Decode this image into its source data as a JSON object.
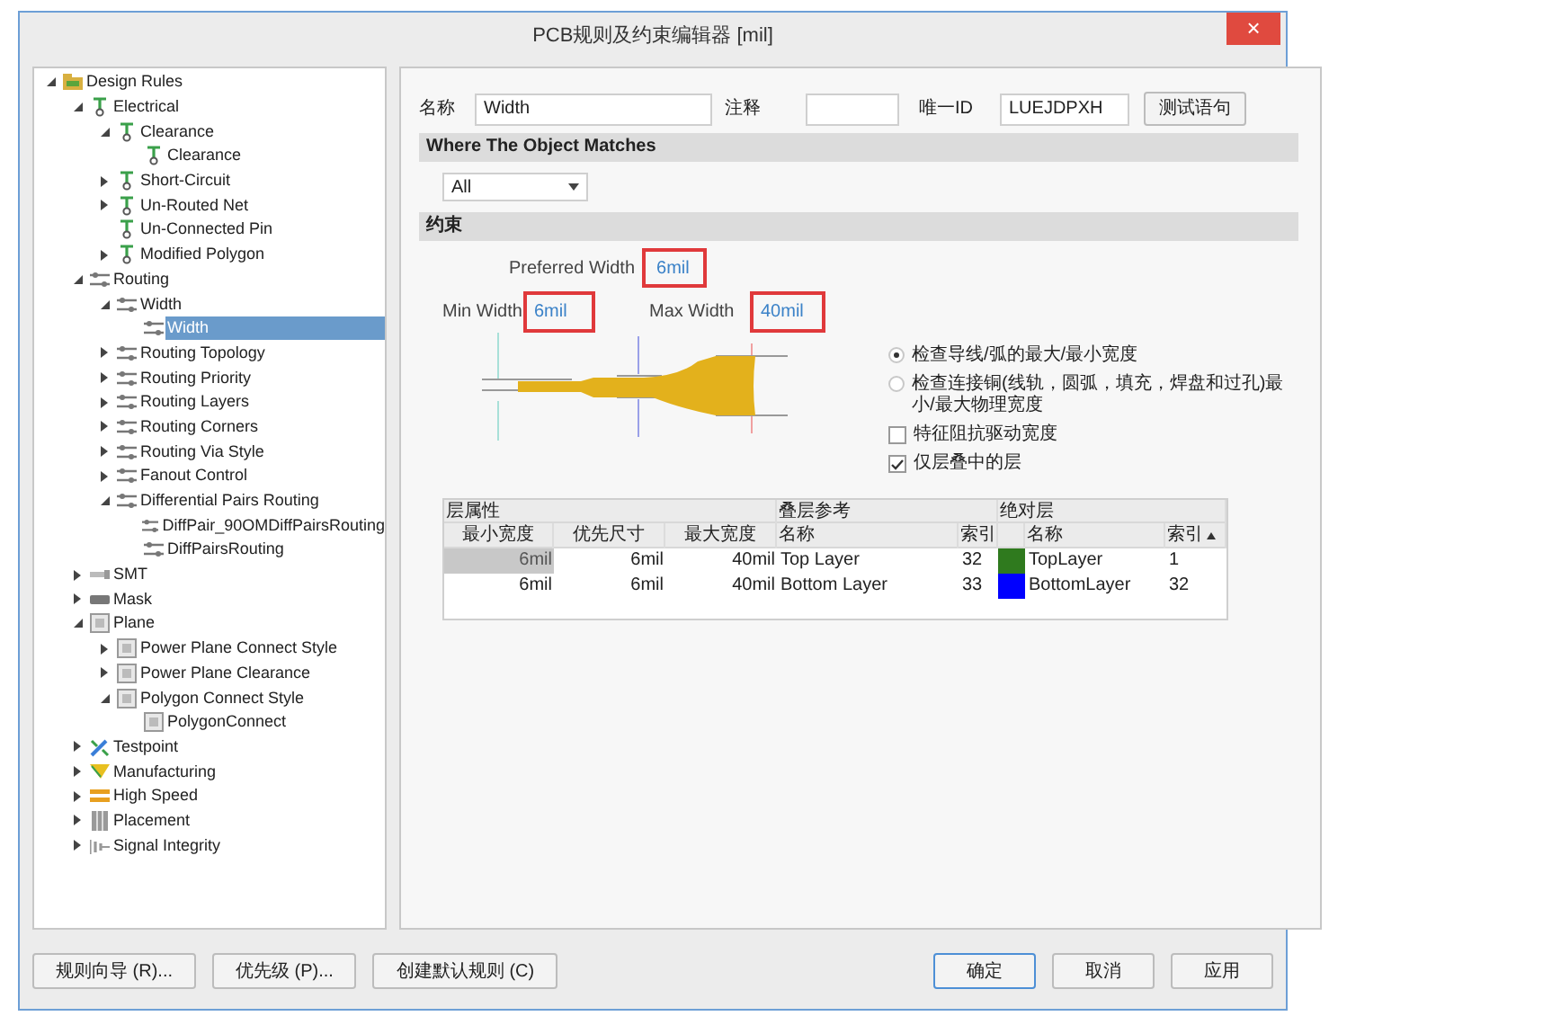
{
  "window": {
    "title": "PCB规则及约束编辑器 [mil]",
    "close": "×"
  },
  "tree": [
    {
      "label": "Design Rules",
      "kind": "folder",
      "expanded": true,
      "selected": false,
      "children": [
        {
          "label": "Electrical",
          "kind": "electrical",
          "expanded": true,
          "selected": false,
          "children": [
            {
              "label": "Clearance",
              "kind": "electrical",
              "expanded": true,
              "selected": false,
              "children": [
                {
                  "label": "Clearance",
                  "kind": "electrical",
                  "selected": false
                }
              ]
            },
            {
              "label": "Short-Circuit",
              "kind": "electrical",
              "expanded": false,
              "selected": false
            },
            {
              "label": "Un-Routed Net",
              "kind": "electrical",
              "expanded": false,
              "selected": false
            },
            {
              "label": "Un-Connected Pin",
              "kind": "electrical",
              "selected": false
            },
            {
              "label": "Modified Polygon",
              "kind": "electrical",
              "expanded": false,
              "selected": false
            }
          ]
        },
        {
          "label": "Routing",
          "kind": "routing",
          "expanded": true,
          "selected": false,
          "children": [
            {
              "label": "Width",
              "kind": "routing",
              "expanded": true,
              "selected": false,
              "children": [
                {
                  "label": "Width",
                  "kind": "routing",
                  "selected": true
                }
              ]
            },
            {
              "label": "Routing Topology",
              "kind": "routing",
              "expanded": false,
              "selected": false
            },
            {
              "label": "Routing Priority",
              "kind": "routing",
              "expanded": false,
              "selected": false
            },
            {
              "label": "Routing Layers",
              "kind": "routing",
              "expanded": false,
              "selected": false
            },
            {
              "label": "Routing Corners",
              "kind": "routing",
              "expanded": false,
              "selected": false
            },
            {
              "label": "Routing Via Style",
              "kind": "routing",
              "expanded": false,
              "selected": false
            },
            {
              "label": "Fanout Control",
              "kind": "routing",
              "expanded": false,
              "selected": false
            },
            {
              "label": "Differential Pairs Routing",
              "kind": "routing",
              "expanded": true,
              "selected": false,
              "children": [
                {
                  "label": "DiffPair_90OMDiffPairsRouting",
                  "kind": "routing",
                  "selected": false
                },
                {
                  "label": "DiffPairsRouting",
                  "kind": "routing",
                  "selected": false
                }
              ]
            }
          ]
        },
        {
          "label": "SMT",
          "kind": "smt",
          "expanded": false,
          "selected": false
        },
        {
          "label": "Mask",
          "kind": "mask",
          "expanded": false,
          "selected": false
        },
        {
          "label": "Plane",
          "kind": "plane",
          "expanded": true,
          "selected": false,
          "children": [
            {
              "label": "Power Plane Connect Style",
              "kind": "plane",
              "expanded": false,
              "selected": false
            },
            {
              "label": "Power Plane Clearance",
              "kind": "plane",
              "expanded": false,
              "selected": false
            },
            {
              "label": "Polygon Connect Style",
              "kind": "plane",
              "expanded": true,
              "selected": false,
              "children": [
                {
                  "label": "PolygonConnect",
                  "kind": "plane",
                  "selected": false
                }
              ]
            }
          ]
        },
        {
          "label": "Testpoint",
          "kind": "testpoint",
          "expanded": false,
          "selected": false
        },
        {
          "label": "Manufacturing",
          "kind": "manufacturing",
          "expanded": false,
          "selected": false
        },
        {
          "label": "High Speed",
          "kind": "highspeed",
          "expanded": false,
          "selected": false
        },
        {
          "label": "Placement",
          "kind": "placement",
          "expanded": false,
          "selected": false
        },
        {
          "label": "Signal Integrity",
          "kind": "signal",
          "expanded": false,
          "selected": false
        }
      ]
    }
  ],
  "rule": {
    "name_label": "名称",
    "name": "Width",
    "comment_label": "注释",
    "id_label": "唯一ID",
    "id": "LUEJDPXH",
    "test_button": "测试语句"
  },
  "where": {
    "header": "Where The Object Matches",
    "scope": "All"
  },
  "constraints": {
    "header": "约束",
    "preferred_label": "Preferred Width",
    "preferred": "6mil",
    "min_label": "Min Width",
    "min": "6mil",
    "max_label": "Max Width",
    "max": "40mil"
  },
  "options": [
    {
      "kind": "radio",
      "label": "检查导线/弧的最大/最小宽度",
      "selected": true
    },
    {
      "kind": "radio",
      "label": "检查连接铜(线轨，圆弧，填充，焊盘和过孔)最小/最大物理宽度",
      "selected": false
    },
    {
      "kind": "checkbox",
      "label": "特征阻抗驱动宽度",
      "checked": false
    },
    {
      "kind": "checkbox",
      "label": "仅层叠中的层",
      "checked": true
    }
  ],
  "table": {
    "groups": [
      "层属性",
      "叠层参考",
      "绝对层"
    ],
    "columns": [
      {
        "label": "最小宽度",
        "sorted": false
      },
      {
        "label": "优先尺寸",
        "sorted": false
      },
      {
        "label": "最大宽度",
        "sorted": false
      },
      {
        "label": "名称",
        "sorted": false
      },
      {
        "label": "索引",
        "sorted": false
      },
      {
        "label": "名称",
        "sorted": false
      },
      {
        "label": "索引",
        "sorted": true
      }
    ],
    "rows": [
      {
        "cells": [
          "6mil",
          "6mil",
          "40mil",
          "Top Layer",
          "32",
          "TopLayer",
          "1"
        ],
        "color": "#2f7a1e",
        "selected": true
      },
      {
        "cells": [
          "6mil",
          "6mil",
          "40mil",
          "Bottom Layer",
          "33",
          "BottomLayer",
          "32"
        ],
        "color": "#0000ff",
        "selected": false
      }
    ]
  },
  "buttons_left": [
    "规则向导 (R)...",
    "优先级 (P)...",
    "创建默认规则 (C)"
  ],
  "buttons_right": [
    {
      "label": "确定",
      "default": true
    },
    {
      "label": "取消",
      "default": false
    },
    {
      "label": "应用",
      "default": false
    }
  ]
}
